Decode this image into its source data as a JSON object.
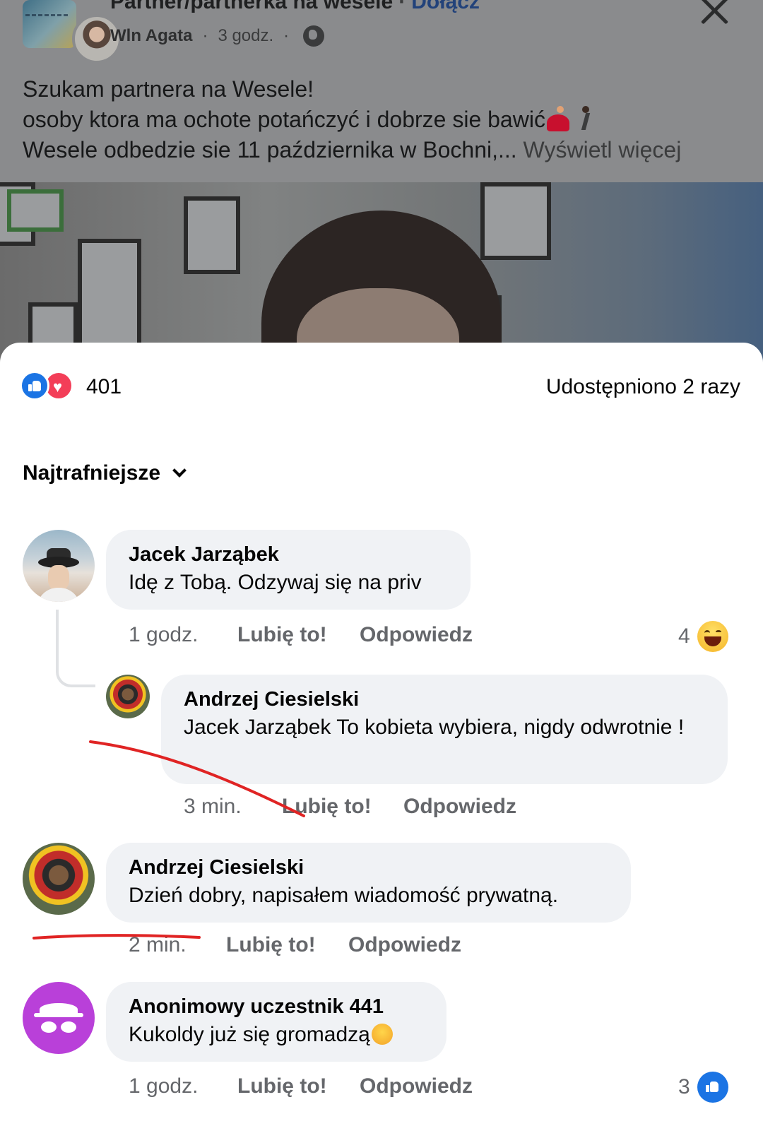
{
  "post": {
    "group_name": "Partner/partnerka na wesele",
    "join_label": "Dołącz",
    "author": "Wln Agata",
    "time": "3 godz.",
    "text_line1": "Szukam partnera na Wesele!",
    "text_line2": "osoby ktora ma ochote potańczyć i dobrze sie bawić",
    "text_line3": "Wesele odbedzie sie 11 października w Bochni,...",
    "see_more": "Wyświetl więcej"
  },
  "stats": {
    "reaction_count": "401",
    "shares": "Udostępniono 2 razy"
  },
  "sort": {
    "label": "Najtrafniejsze"
  },
  "comments": [
    {
      "name": "Jacek Jarząbek",
      "text": "Idę z Tobą. Odzywaj się na priv",
      "time": "1 godz.",
      "like": "Lubię to!",
      "reply": "Odpowiedz",
      "reaction_count": "4",
      "reaction_icon": "haha-icon"
    },
    {
      "name": "Andrzej Ciesielski",
      "text": "Jacek Jarząbek To kobieta wybiera, nigdy odwrotnie !",
      "time": "3 min.",
      "like": "Lubię to!",
      "reply": "Odpowiedz"
    },
    {
      "name": "Andrzej Ciesielski",
      "text": "Dzień dobry, napisałem wiadomość prywatną.",
      "time": "2 min.",
      "like": "Lubię to!",
      "reply": "Odpowiedz"
    },
    {
      "name": "Anonimowy uczestnik 441",
      "text": "Kukoldy już się gromadzą",
      "time": "1 godz.",
      "like": "Lubię to!",
      "reply": "Odpowiedz",
      "reaction_count": "3",
      "reaction_icon": "like-icon"
    }
  ],
  "colors": {
    "like_blue": "#1b74e4",
    "love_red": "#f33e58",
    "bubble_bg": "#f0f2f5",
    "meta_gray": "#65676b",
    "annotation_red": "#e02424",
    "anon_avatar": "#b940d9"
  }
}
